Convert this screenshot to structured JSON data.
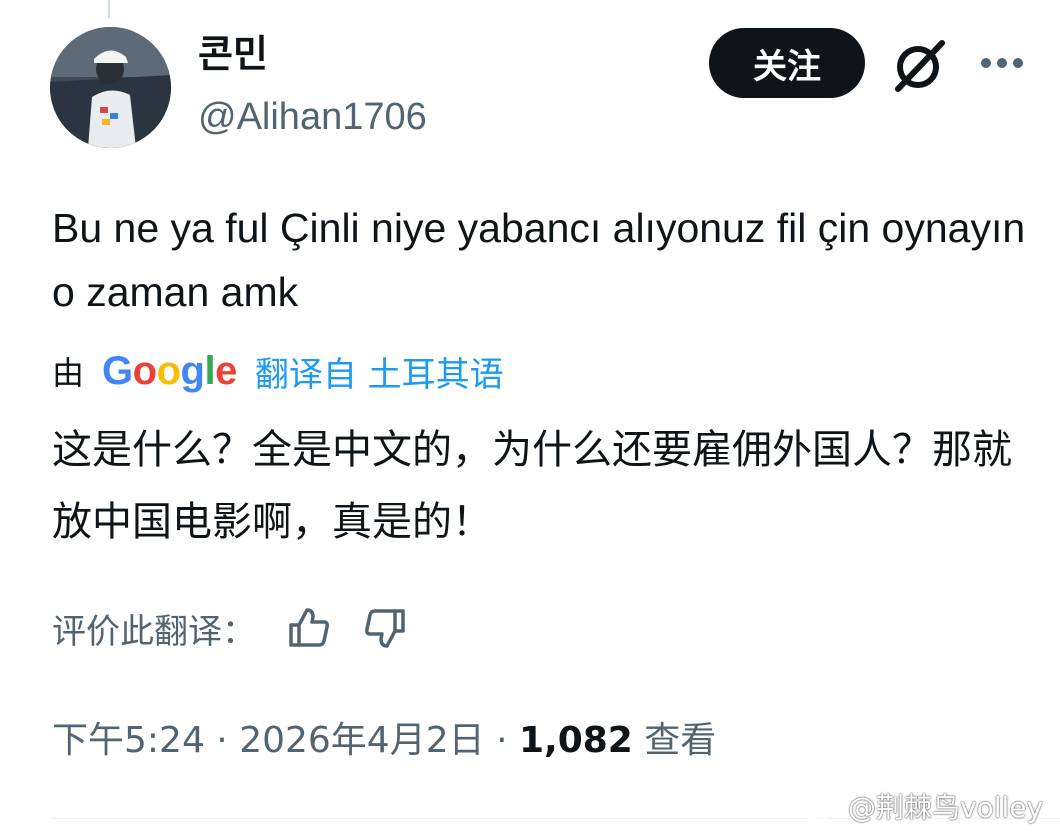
{
  "tweet": {
    "author": {
      "display_name": "콘민",
      "handle": "@Alihan1706"
    },
    "follow_label": "关注",
    "text": "Bu ne ya ful Çinli niye yabancı alıyonuz fil çin oynayın o zaman amk",
    "translation": {
      "by_label": "由",
      "provider": "Google",
      "link_label": "翻译自 土耳其语",
      "text": "这是什么？全是中文的，为什么还要雇佣外国人？那就放中国电影啊，真是的！"
    },
    "rate_label": "评价此翻译：",
    "meta": {
      "time": "下午5:24",
      "separator": " · ",
      "date": "2026年4月2日",
      "views_count": "1,082",
      "views_label": "查看"
    }
  },
  "watermark": {
    "text": "@荆棘鸟volley"
  },
  "icons": {
    "grok": "grok-icon",
    "more": "more-icon",
    "thumbs_up": "thumbs-up-icon",
    "thumbs_down": "thumbs-down-icon",
    "weibo": "weibo-logo-icon"
  },
  "colors": {
    "text": "#0f1419",
    "secondary": "#536471",
    "link": "#1d9bf0",
    "button_bg": "#0f1419"
  }
}
